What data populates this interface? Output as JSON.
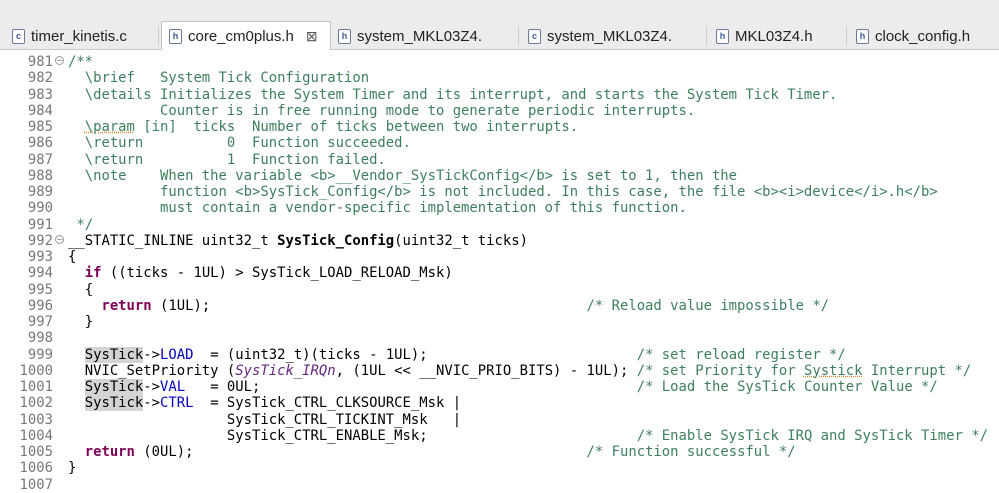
{
  "tabs": [
    {
      "icon": "c",
      "label": "timer_kinetis.c"
    },
    {
      "icon": "h",
      "label": "core_cm0plus.h",
      "active": true,
      "close": "⊠"
    },
    {
      "icon": "h",
      "label": "system_MKL03Z4."
    },
    {
      "icon": "c",
      "label": "system_MKL03Z4."
    },
    {
      "icon": "h",
      "label": "MKL03Z4.h"
    },
    {
      "icon": "h",
      "label": "clock_config.h"
    }
  ],
  "fold_glyph": "−",
  "lines": [
    {
      "n": "981",
      "fold": true,
      "segs": [
        [
          "cm",
          "/**"
        ]
      ]
    },
    {
      "n": "982",
      "segs": [
        [
          "cm",
          "  \\brief   System Tick Configuration"
        ]
      ]
    },
    {
      "n": "983",
      "segs": [
        [
          "cm",
          "  \\details Initializes the System Timer and its interrupt, and starts the System Tick Timer."
        ]
      ]
    },
    {
      "n": "984",
      "segs": [
        [
          "cm",
          "           Counter is in free running mode to generate periodic interrupts."
        ]
      ]
    },
    {
      "n": "985",
      "segs": [
        [
          "cm",
          "  "
        ],
        [
          "cm dv",
          "\\param"
        ],
        [
          "cm",
          " [in]  ticks  Number of ticks between two interrupts."
        ]
      ]
    },
    {
      "n": "986",
      "segs": [
        [
          "cm",
          "  \\return          0  Function succeeded."
        ]
      ]
    },
    {
      "n": "987",
      "segs": [
        [
          "cm",
          "  \\return          1  Function failed."
        ]
      ]
    },
    {
      "n": "988",
      "segs": [
        [
          "cm",
          "  \\note    When the variable <b>__Vendor_SysTickConfig</b> is set to 1, then the"
        ]
      ]
    },
    {
      "n": "989",
      "segs": [
        [
          "cm",
          "           function <b>SysTick_Config</b> is not included. In this case, the file <b><i>device</i>.h</b>"
        ]
      ]
    },
    {
      "n": "990",
      "segs": [
        [
          "cm",
          "           must contain a vendor-specific implementation of this function."
        ]
      ]
    },
    {
      "n": "991",
      "segs": [
        [
          "cm",
          " */"
        ]
      ]
    },
    {
      "n": "992",
      "fold": true,
      "segs": [
        [
          "",
          "__STATIC_INLINE uint32_t "
        ],
        [
          "fn",
          "SysTick_Config"
        ],
        [
          "",
          "(uint32_t ticks)"
        ]
      ]
    },
    {
      "n": "993",
      "segs": [
        [
          "",
          "{"
        ]
      ]
    },
    {
      "n": "994",
      "segs": [
        [
          "",
          "  "
        ],
        [
          "kw",
          "if"
        ],
        [
          "",
          " ((ticks - 1UL) > SysTick_LOAD_RELOAD_Msk)"
        ]
      ]
    },
    {
      "n": "995",
      "segs": [
        [
          "",
          "  {"
        ]
      ]
    },
    {
      "n": "996",
      "segs": [
        [
          "",
          "    "
        ],
        [
          "kw",
          "return"
        ],
        [
          "",
          " (1UL);                                             "
        ],
        [
          "cm",
          "/* Reload value impossible */"
        ]
      ]
    },
    {
      "n": "997",
      "segs": [
        [
          "",
          "  }"
        ]
      ]
    },
    {
      "n": "998",
      "segs": [
        [
          "",
          ""
        ]
      ]
    },
    {
      "n": "999",
      "segs": [
        [
          "",
          "  "
        ],
        [
          "hl",
          "SysTick"
        ],
        [
          "",
          "->"
        ],
        [
          "fld",
          "LOAD"
        ],
        [
          "",
          "  = (uint32_t)(ticks - 1UL);                         "
        ],
        [
          "cm",
          "/* set reload register */"
        ]
      ]
    },
    {
      "n": "1000",
      "segs": [
        [
          "",
          "  NVIC_SetPriority ("
        ],
        [
          "mac",
          "SysTick_IRQn"
        ],
        [
          "",
          ", (1UL << __NVIC_PRIO_BITS) - 1UL); "
        ],
        [
          "cm",
          "/* set Priority for "
        ],
        [
          "cm dv",
          "Systick"
        ],
        [
          "cm",
          " Interrupt */"
        ]
      ]
    },
    {
      "n": "1001",
      "segs": [
        [
          "",
          "  "
        ],
        [
          "hl",
          "SysTick"
        ],
        [
          "",
          "->"
        ],
        [
          "fld",
          "VAL"
        ],
        [
          "",
          "   = 0UL;                                             "
        ],
        [
          "cm",
          "/* Load the SysTick Counter Value */"
        ]
      ]
    },
    {
      "n": "1002",
      "segs": [
        [
          "",
          "  "
        ],
        [
          "hl",
          "SysTick"
        ],
        [
          "",
          "->"
        ],
        [
          "fld",
          "CTRL"
        ],
        [
          "",
          "  = SysTick_CTRL_CLKSOURCE_Msk |"
        ]
      ]
    },
    {
      "n": "1003",
      "segs": [
        [
          "",
          "                   SysTick_CTRL_TICKINT_Msk   |"
        ]
      ]
    },
    {
      "n": "1004",
      "segs": [
        [
          "",
          "                   SysTick_CTRL_ENABLE_Msk;                         "
        ],
        [
          "cm",
          "/* Enable SysTick IRQ and SysTick Timer */"
        ]
      ]
    },
    {
      "n": "1005",
      "segs": [
        [
          "",
          "  "
        ],
        [
          "kw",
          "return"
        ],
        [
          "",
          " (0UL);                                               "
        ],
        [
          "cm",
          "/* Function successful */"
        ]
      ]
    },
    {
      "n": "1006",
      "segs": [
        [
          "",
          "}"
        ]
      ]
    },
    {
      "n": "1007",
      "segs": [
        [
          "",
          ""
        ]
      ]
    }
  ]
}
